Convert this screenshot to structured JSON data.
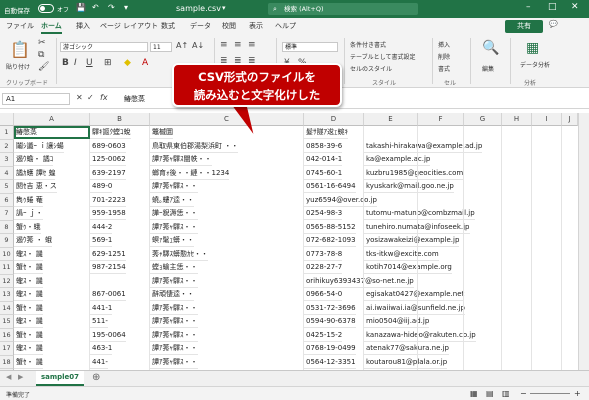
{
  "titlebar": {
    "autosave_label": "自動保存",
    "autosave_state": "オフ",
    "filename": "sample.csv",
    "dropdown": "▾",
    "search_placeholder": "検索 (Alt+Q)"
  },
  "ribbon_tabs": [
    "ファイル",
    "ホーム",
    "挿入",
    "ページ レイアウト",
    "数式",
    "データ",
    "校閲",
    "表示",
    "ヘルプ"
  ],
  "active_tab": "ホーム",
  "share_label": "共有",
  "comment_label": "",
  "ribbon": {
    "paste_label": "貼り付け",
    "font_name": "游ゴシック",
    "font_size": "11",
    "number_format": "標準",
    "cond_format": "条件付き書式",
    "table_format": "テーブルとして書式設定",
    "cell_style": "セルのスタイル",
    "insert": "挿入",
    "delete": "削除",
    "format": "書式",
    "edit": "編集",
    "data_analysis": "データ分析",
    "groups": {
      "clipboard": "クリップボード",
      "style": "スタイル",
      "cells": "セル",
      "analysis": "分析"
    }
  },
  "formula_bar": {
    "name_box": "A1",
    "fx": "fx",
    "value": "鰆憋蒸"
  },
  "columns": [
    "A",
    "B",
    "C",
    "D",
    "E",
    "F",
    "G",
    "H",
    "I",
    "J"
  ],
  "rows": [
    [
      "鰆憋蒸",
      "驛ｷ謳ｸ螳ｺ蛻",
      "鼈槭圜",
      "髮ｻ隧ｱ逡ｪ蜿ｷ",
      "",
      "",
      ""
    ],
    [
      "鬮ｼ讖ｰ ｉ讓ｼ蝪",
      "689-0603",
      "鳥取県東伯郡湯梨浜町 ・・",
      "0858-39-6",
      "takashi-hirakawa@example.ad.jp",
      "",
      ""
    ],
    [
      "遏ｳ蟾・ 譎ｺ",
      "125-0062",
      "譚ｱ莠ｬ驛ｽ闡帙・・",
      "042-014-1",
      "ka@example.ac.jp",
      "",
      ""
    ],
    [
      "譎ｶ蠖 譚ｾ 蝗",
      "639-2197",
      "螂育ｫ後・・縺・・1234",
      "0745-60-1",
      "kuzbru1985@geocities.com",
      "",
      ""
    ],
    [
      "閼ｾ吉 恵・ス",
      "489-0",
      "譚ｱ莠ｬ驛ｽ・・",
      "0561-16-6494",
      "kyuskark@mail.goo.ne.jp",
      "",
      ""
    ],
    [
      "雋ｩ蜷 菴",
      "701-2223",
      "蟯｡螻ｱ逵・・",
      "yuz6594@over.co.jp",
      "",
      "",
      ""
    ],
    [
      "譌ｰ ｊ・",
      "959-1958",
      "譁ｰ貎溽恁・・",
      "0254-98-3",
      "tutomu-matuno@combzmail.jp",
      "",
      ""
    ],
    [
      "蟹ｩ・蛾",
      "444-2",
      "譚ｱ莠ｬ驛ｽ・・",
      "0565-88-5152",
      "tunehiro.numata@infoseek.jp",
      "",
      ""
    ],
    [
      "遏ｳ莠 ・ 蛾",
      "569-1",
      "螟ｧ髦ｪ蠎・・",
      "072-682-1093",
      "yosizawakeizi@example.jp",
      "",
      ""
    ],
    [
      "蟶ｽ・ 譏",
      "629-1251",
      "莠ｬ驛ｽ蠎懃ｶｾ・・",
      "0773-78-8",
      "tks-itkw@excite.com",
      "",
      ""
    ],
    [
      "蟹ｾ・ 譏",
      "987-2154",
      "螳ｮ蝓主恁・・",
      "0228-27-7",
      "kotih7014@example.org",
      "",
      ""
    ],
    [
      "蟶ｽ・ 譏",
      "",
      "譚ｱ莠ｬ驛ｽ・・",
      "orihikuy6393437@so-net.ne.jp",
      "",
      "",
      ""
    ],
    [
      "蟶ｽ・ 譏",
      "867-0061",
      "辭頑悽逵・・",
      "0966-54-0",
      "egisakat0427@example.net",
      "",
      ""
    ],
    [
      "蟹ｾ・ 譏",
      "441-1",
      "譚ｱ莠ｬ驛ｽ・・",
      "0531-72-3696",
      "ai.iwaiiwai.ia@sunfield.ne.jp",
      "",
      ""
    ],
    [
      "蟶ｽ・ 譏",
      "511-",
      "譚ｱ莠ｬ驛ｽ・・",
      "0594-90-6378",
      "mio0504@iij.ad.jp",
      "",
      ""
    ],
    [
      "蟹ｾ・ 譏",
      "195-0064",
      "譚ｱ莠ｬ驛ｽ・・",
      "0425-15-2",
      "kanazawa-hideo@rakuten.co.jp",
      "",
      ""
    ],
    [
      "蟶ｽ・ 譏",
      "463-1",
      "譚ｱ莠ｬ驛ｽ・・",
      "0768-19-0499",
      "atenak77@sakura.ne.jp",
      "",
      ""
    ],
    [
      "蟹ｾ・ 譏",
      "441-",
      "譚ｱ莠ｬ驛ｽ・・",
      "0564-12-3351",
      "koutarou81@plala.or.jp",
      "",
      ""
    ]
  ],
  "sheet_tab": "sample07",
  "status_text": "準備完了",
  "callout": {
    "line1": "CSV形式のファイルを",
    "line2": "読み込むと文字化けした"
  },
  "colors": {
    "excel_green": "#217346",
    "callout_red": "#c00000"
  }
}
